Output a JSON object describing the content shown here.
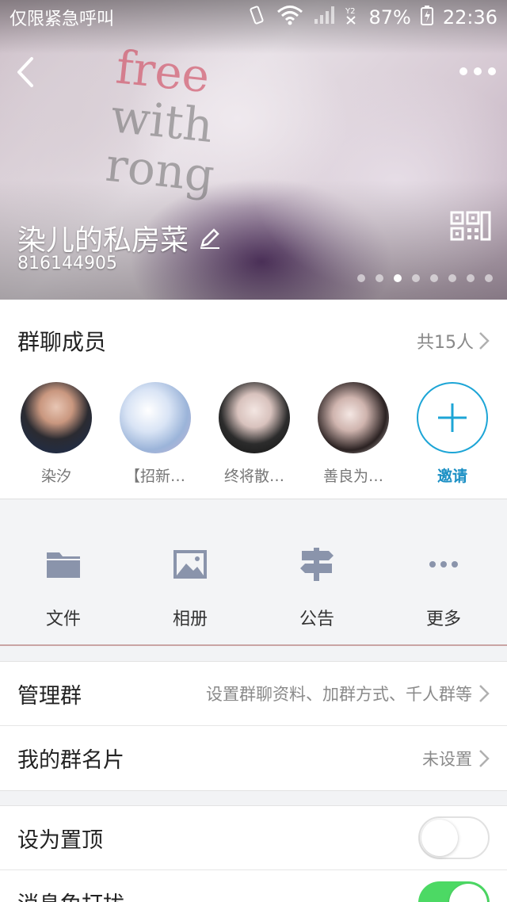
{
  "status_bar": {
    "carrier": "仅限紧急呼叫",
    "battery": "87%",
    "time": "22:36"
  },
  "header": {
    "group_name": "染儿的私房菜",
    "group_id": "816144905",
    "page_count": 8,
    "active_page": 3
  },
  "members": {
    "title": "群聊成员",
    "count_label": "共15人",
    "list": [
      {
        "name": "染汐"
      },
      {
        "name": "【招新…"
      },
      {
        "name": "终将散…"
      },
      {
        "name": "善良为…"
      }
    ],
    "invite_label": "邀请"
  },
  "actions": [
    {
      "label": "文件",
      "icon": "folder-icon"
    },
    {
      "label": "相册",
      "icon": "image-icon"
    },
    {
      "label": "公告",
      "icon": "signpost-icon"
    },
    {
      "label": "更多",
      "icon": "more-dots-icon"
    }
  ],
  "settings": {
    "manage": {
      "title": "管理群",
      "value": "设置群聊资料、加群方式、千人群等"
    },
    "card": {
      "title": "我的群名片",
      "value": "未设置"
    },
    "pin": {
      "title": "设为置顶",
      "on": false
    },
    "mute": {
      "title": "消息免打扰",
      "on": true
    }
  },
  "colors": {
    "accent": "#1da5d6",
    "toggle_on": "#4cd964",
    "icon_gray": "#8a94ab"
  }
}
